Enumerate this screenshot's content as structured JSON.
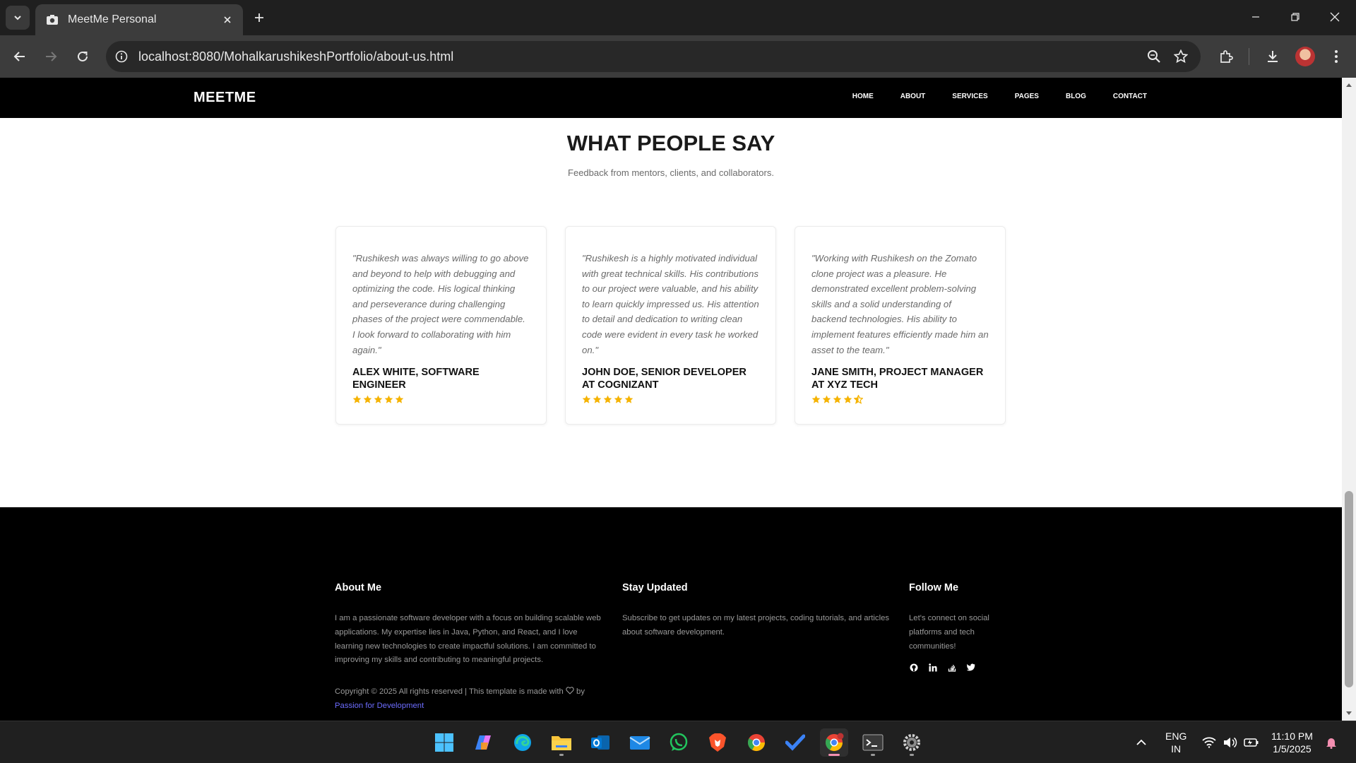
{
  "browser": {
    "tab_title": "MeetMe Personal",
    "url": "localhost:8080/MohalkarushikeshPortfolio/about-us.html"
  },
  "site": {
    "brand": "MEETME",
    "nav": [
      "HOME",
      "ABOUT",
      "SERVICES",
      "PAGES",
      "BLOG",
      "CONTACT"
    ],
    "testimonials": {
      "title": "WHAT PEOPLE SAY",
      "subtitle": "Feedback from mentors, clients, and collaborators.",
      "items": [
        {
          "quote": "\"Rushikesh was always willing to go above and beyond to help with debugging and optimizing the code. His logical thinking and perseverance during challenging phases of the project were commendable. I look forward to collaborating with him again.\"",
          "author": "ALEX WHITE, SOFTWARE ENGINEER",
          "rating": 5
        },
        {
          "quote": "\"Rushikesh is a highly motivated individual with great technical skills. His contributions to our project were valuable, and his ability to learn quickly impressed us. His attention to detail and dedication to writing clean code were evident in every task he worked on.\"",
          "author": "JOHN DOE, SENIOR DEVELOPER AT COGNIZANT",
          "rating": 5
        },
        {
          "quote": "\"Working with Rushikesh on the Zomato clone project was a pleasure. He demonstrated excellent problem-solving skills and a solid understanding of backend technologies. His ability to implement features efficiently made him an asset to the team.\"",
          "author": "JANE SMITH, PROJECT MANAGER AT XYZ TECH",
          "rating": 4.5
        }
      ]
    },
    "footer": {
      "about_title": "About Me",
      "about_text": "I am a passionate software developer with a focus on building scalable web applications. My expertise lies in Java, Python, and React, and I love learning new technologies to create impactful solutions. I am committed to improving my skills and contributing to meaningful projects.",
      "copyright_text": "Copyright © 2025 All rights reserved | This template is made with",
      "copyright_by": "by",
      "copyright_link": "Passion for Development",
      "updates_title": "Stay Updated",
      "updates_text": "Subscribe to get updates on my latest projects, coding tutorials, and articles about software development.",
      "follow_title": "Follow Me",
      "follow_text": "Let's connect on social platforms and tech communities!",
      "socials": [
        "github-icon",
        "linkedin-icon",
        "stackoverflow-icon",
        "twitter-icon"
      ]
    }
  },
  "taskbar": {
    "language": "ENG",
    "region": "IN",
    "time": "11:10 PM",
    "date": "1/5/2025"
  },
  "colors": {
    "star": "#f5b301",
    "footer_link": "#6d6dff",
    "active_indicator": "#f48fb1"
  }
}
